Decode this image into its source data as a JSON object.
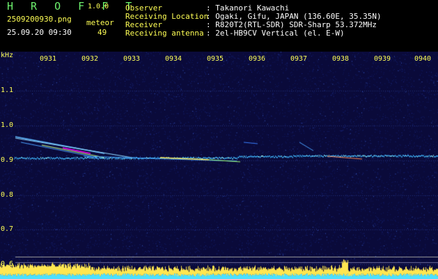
{
  "header": {
    "app_name": "H R O F F T",
    "version": "1.0.0",
    "filename": "2509200930.png",
    "datetime": "25.09.20 09:30",
    "meteor_label": "meteor",
    "meteor_count": "49",
    "meta": [
      {
        "label": "Observer",
        "value": ": Takanori Kawachi"
      },
      {
        "label": "Receiving Location",
        "value": ": Ogaki, Gifu, JAPAN (136.60E, 35.35N)"
      },
      {
        "label": "Receiver",
        "value": ": R820T2(RTL-SDR) SDR-Sharp 53.372MHz"
      },
      {
        "label": "Receiving antenna",
        "value": ": 2el-HB9CV Vertical (el. E-W)"
      }
    ]
  },
  "spectrogram": {
    "unit": "kHz",
    "time_ticks": [
      "0931",
      "0932",
      "0933",
      "0934",
      "0935",
      "0936",
      "0937",
      "0938",
      "0939",
      "0940"
    ],
    "freq_ticks": [
      "1.1",
      "1.0",
      "0.9",
      "0.8",
      "0.7",
      "0.6"
    ],
    "freq_tick_values": [
      1.1,
      1.0,
      0.9,
      0.8,
      0.7,
      0.6
    ],
    "freq_range": [
      0.58,
      1.19
    ],
    "colors": {
      "background": "#0a0a3a",
      "signal": "#ffe650",
      "noise_level": "#4de0ff",
      "peak": "#ff00ff"
    }
  }
}
